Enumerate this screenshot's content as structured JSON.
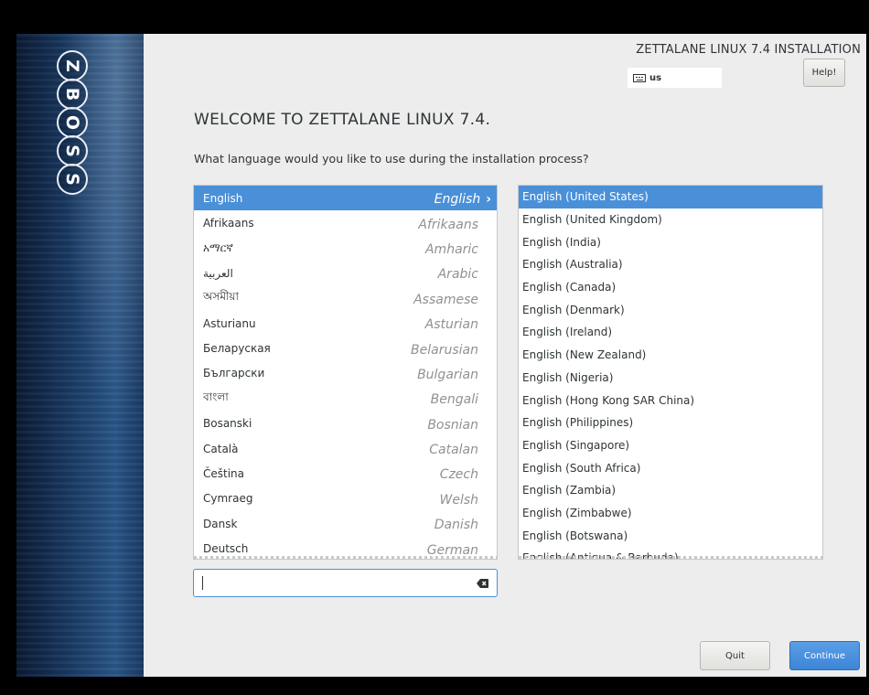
{
  "sidebar": {
    "logo_letters": [
      "Z",
      "B",
      "O",
      "S",
      "S"
    ]
  },
  "header": {
    "product_title": "ZETTALANE LINUX 7.4 INSTALLATION",
    "keyboard_layout": "us",
    "help_label": "Help!"
  },
  "main": {
    "welcome": "WELCOME TO ZETTALANE LINUX 7.4.",
    "prompt": "What language would you like to use during the installation process?",
    "languages": [
      {
        "native": "English",
        "english": "English",
        "selected": true
      },
      {
        "native": "Afrikaans",
        "english": "Afrikaans"
      },
      {
        "native": "አማርኛ",
        "english": "Amharic"
      },
      {
        "native": "العربية",
        "english": "Arabic"
      },
      {
        "native": "অসমীয়া",
        "english": "Assamese"
      },
      {
        "native": "Asturianu",
        "english": "Asturian"
      },
      {
        "native": "Беларуская",
        "english": "Belarusian"
      },
      {
        "native": "Български",
        "english": "Bulgarian"
      },
      {
        "native": "বাংলা",
        "english": "Bengali"
      },
      {
        "native": "Bosanski",
        "english": "Bosnian"
      },
      {
        "native": "Català",
        "english": "Catalan"
      },
      {
        "native": "Čeština",
        "english": "Czech"
      },
      {
        "native": "Cymraeg",
        "english": "Welsh"
      },
      {
        "native": "Dansk",
        "english": "Danish"
      },
      {
        "native": "Deutsch",
        "english": "German"
      }
    ],
    "locales": [
      {
        "label": "English (United States)",
        "selected": true
      },
      {
        "label": "English (United Kingdom)"
      },
      {
        "label": "English (India)"
      },
      {
        "label": "English (Australia)"
      },
      {
        "label": "English (Canada)"
      },
      {
        "label": "English (Denmark)"
      },
      {
        "label": "English (Ireland)"
      },
      {
        "label": "English (New Zealand)"
      },
      {
        "label": "English (Nigeria)"
      },
      {
        "label": "English (Hong Kong SAR China)"
      },
      {
        "label": "English (Philippines)"
      },
      {
        "label": "English (Singapore)"
      },
      {
        "label": "English (South Africa)"
      },
      {
        "label": "English (Zambia)"
      },
      {
        "label": "English (Zimbabwe)"
      },
      {
        "label": "English (Botswana)"
      },
      {
        "label": "English (Antigua & Barbuda)"
      }
    ],
    "search": {
      "value": "",
      "placeholder": ""
    }
  },
  "footer": {
    "quit_label": "Quit",
    "continue_label": "Continue"
  },
  "colors": {
    "accent": "#4a90d9",
    "background": "#ededed",
    "sidebar": "#1a3c66"
  }
}
